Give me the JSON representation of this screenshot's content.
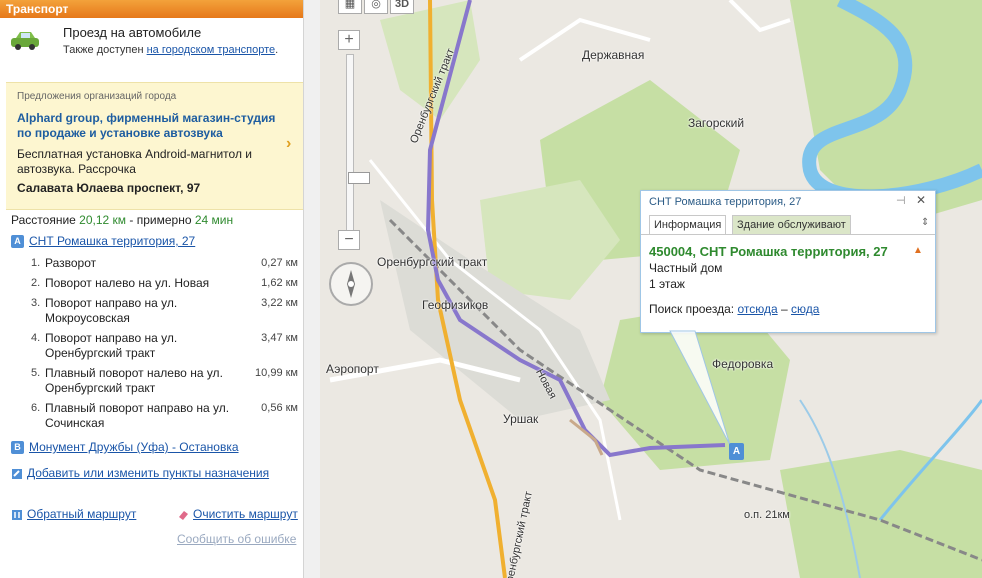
{
  "panel": {
    "header": "Транспорт",
    "drive_title": "Проезд на автомобиле",
    "also_prefix": "Также доступен",
    "also_link": "на городском транспорте",
    "also_suffix": ".",
    "promo": {
      "heading": "Предложения организаций города",
      "title": "Alphard group, фирменный магазин-студия по продаже и установке автозвука",
      "description": "Бесплатная установка Android-магнитол и автозвука. Рассрочка",
      "address": "Салавата Юлаева проспект, 97",
      "arrow": "›"
    },
    "summary": {
      "label": "Расстояние",
      "distance": "20,12 км",
      "middle": "- примерно",
      "time": "24 мин"
    },
    "point_a": {
      "badge": "A",
      "label": "СНТ Ромашка территория, 27"
    },
    "steps": [
      {
        "num": "1.",
        "text": "Разворот",
        "dist": "0,27 км"
      },
      {
        "num": "2.",
        "text": "Поворот налево на ул. Новая",
        "dist": "1,62 км"
      },
      {
        "num": "3.",
        "text": "Поворот направо на ул. Мокроусовская",
        "dist": "3,22 км"
      },
      {
        "num": "4.",
        "text": "Поворот направо на ул. Оренбургский тракт",
        "dist": "3,47 км"
      },
      {
        "num": "5.",
        "text": "Плавный поворот налево на ул. Оренбургский тракт",
        "dist": "10,99 км"
      },
      {
        "num": "6.",
        "text": "Плавный поворот направо на ул. Сочинская",
        "dist": "0,56 км"
      }
    ],
    "point_b": {
      "badge": "B",
      "label": "Монумент Дружбы (Уфа) - Остановка"
    },
    "add_points": "Добавить или изменить пункты назначения",
    "reverse_route": "Обратный маршрут",
    "clear_route": "Очистить маршрут",
    "report_error": "Сообщить об ошибке"
  },
  "map": {
    "labels": {
      "derzhavnaya": "Державная",
      "zagorsky": "Загорский",
      "orenburg_road_top": "Оренбургский тракт",
      "orenburg_road_mid": "Оренбургский тракт",
      "geofizikov": "Геофизиков",
      "airport": "Аэропорт",
      "novaya": "Новая",
      "urshak": "Уршак",
      "fedorovka": "Федоровка",
      "op21": "о.п. 21км",
      "orenburg_road_bottom": "Оренбургский тракт"
    },
    "view_3d": "3D",
    "zoom_in": "+",
    "zoom_out": "−",
    "zoom_level": 0.72,
    "marker_a": "A"
  },
  "popup": {
    "header": "СНТ Ромашка территория, 27",
    "pin": "⊣",
    "close": "✕",
    "tabs": [
      "Информация",
      "Здание обслуживают"
    ],
    "dropdown": "⇕",
    "address": "450004, СНТ Ромашка территория, 27",
    "warn": "▲",
    "type": "Частный дом",
    "floors": "1 этаж",
    "search_label": "Поиск проезда:",
    "from_here": "отсюда",
    "dash": "–",
    "to_here": "сюда"
  },
  "colors": {
    "route": "#8877cc",
    "highway": "#f0b030",
    "water": "#7ec4ec",
    "forest": "#c6dfa4",
    "accent_orange": "#e6781a"
  }
}
